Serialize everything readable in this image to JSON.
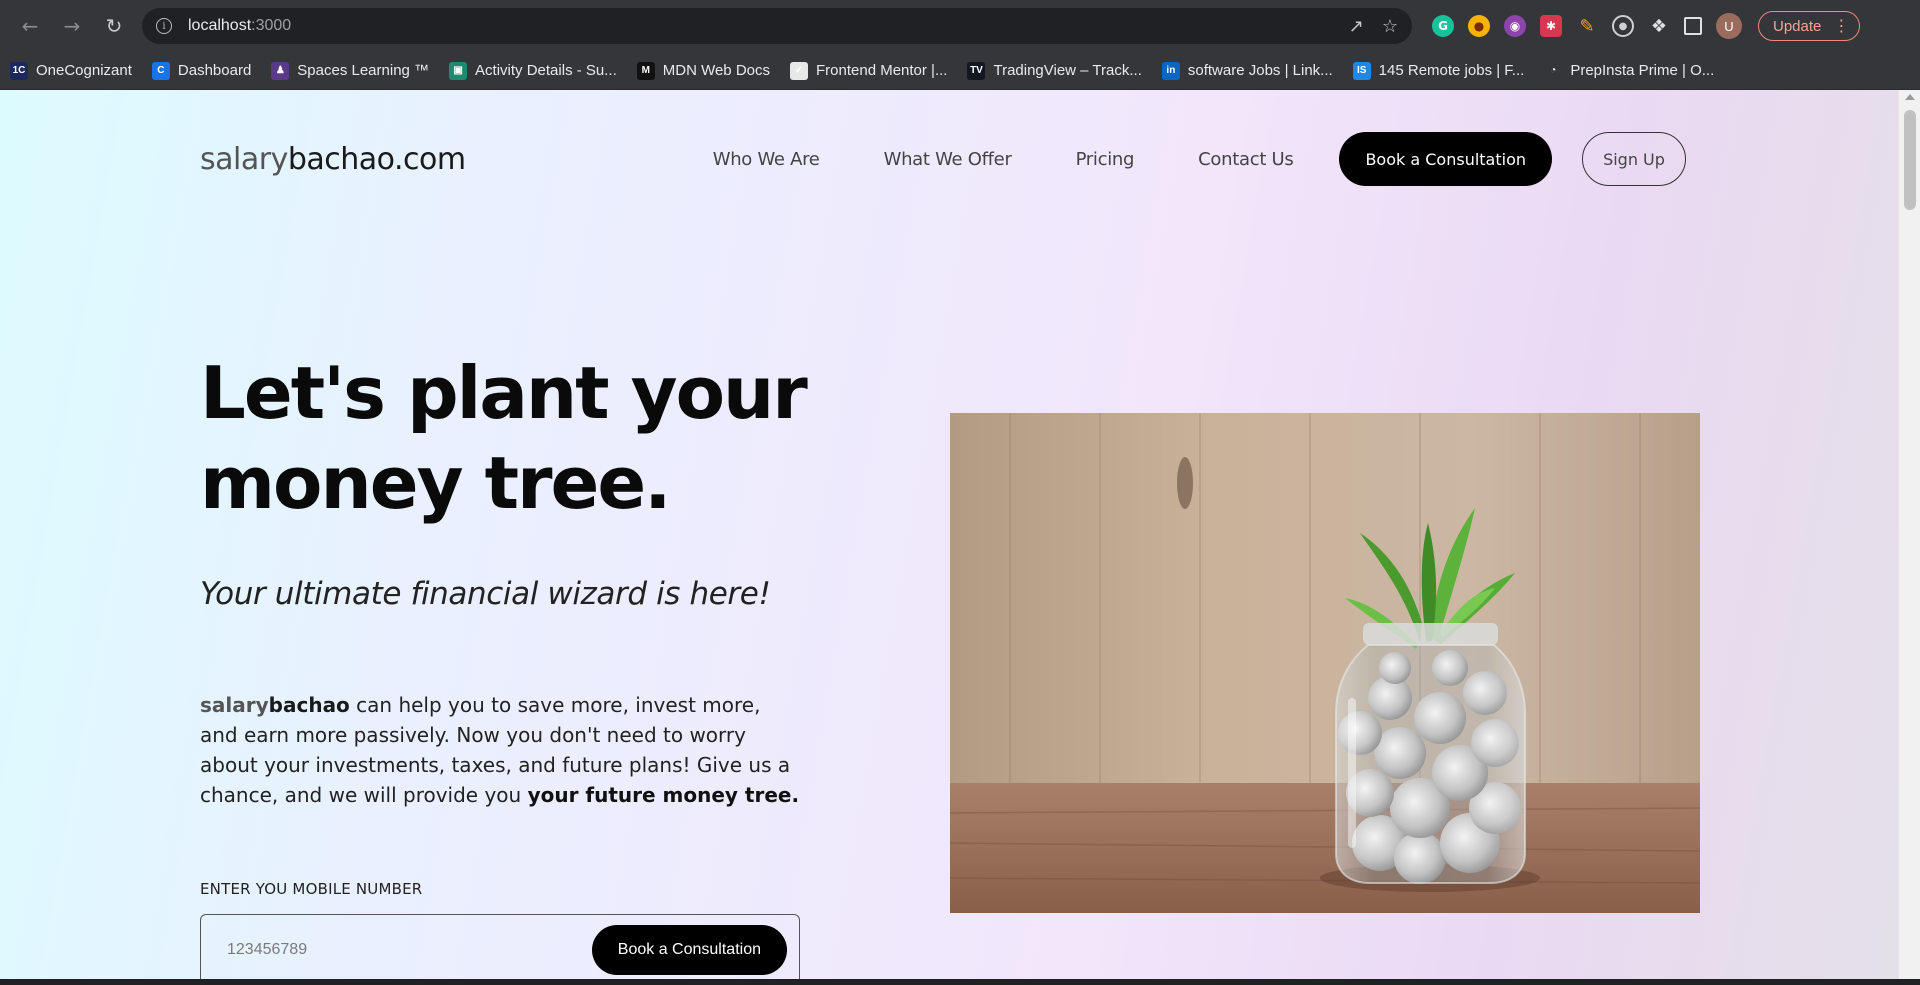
{
  "browser": {
    "url_host": "localhost",
    "url_port": ":3000",
    "update_label": "Update",
    "profile_initial": "U",
    "bookmarks": [
      {
        "label": "OneCognizant",
        "fav": "1C",
        "color": "#1b2a5b"
      },
      {
        "label": "Dashboard",
        "fav": "C",
        "color": "#1a73e8"
      },
      {
        "label": "Spaces Learning ™",
        "fav": "♟",
        "color": "#5b3a8c"
      },
      {
        "label": "Activity Details - Su...",
        "fav": "▣",
        "color": "#1f8a70"
      },
      {
        "label": "MDN Web Docs",
        "fav": "M",
        "color": "#111111"
      },
      {
        "label": "Frontend Mentor |...",
        "fav": "✓",
        "color": "#e8e8e8"
      },
      {
        "label": "TradingView – Track...",
        "fav": "TV",
        "color": "#131722"
      },
      {
        "label": "software Jobs | Link...",
        "fav": "in",
        "color": "#0a66c2"
      },
      {
        "label": "145 Remote jobs | F...",
        "fav": "IS",
        "color": "#1f88e5"
      },
      {
        "label": "PrepInsta Prime | O...",
        "fav": "◔",
        "color": "#35363a"
      }
    ]
  },
  "header": {
    "logo_part1": "salary",
    "logo_part2": "bachao.com",
    "nav": [
      "Who We Are",
      "What We Offer",
      "Pricing",
      "Contact Us"
    ],
    "cta_label": "Book a Consultation",
    "signup_label": "Sign Up"
  },
  "hero": {
    "title_line1": "Let's plant your",
    "title_line2": "money tree.",
    "subtitle": "Your ultimate financial wizard is here!",
    "desc_brand1": "salary",
    "desc_brand2": "bachao",
    "desc_text": " can help you to save more, invest more, and earn more passively. Now you don't need to worry about your investments, taxes, and future plans! Give us a chance, and we will provide you ",
    "desc_strong": "your future money tree.",
    "mobile_label": "ENTER YOU MOBILE NUMBER",
    "mobile_placeholder": "123456789",
    "mobile_button": "Book a Consultation"
  }
}
